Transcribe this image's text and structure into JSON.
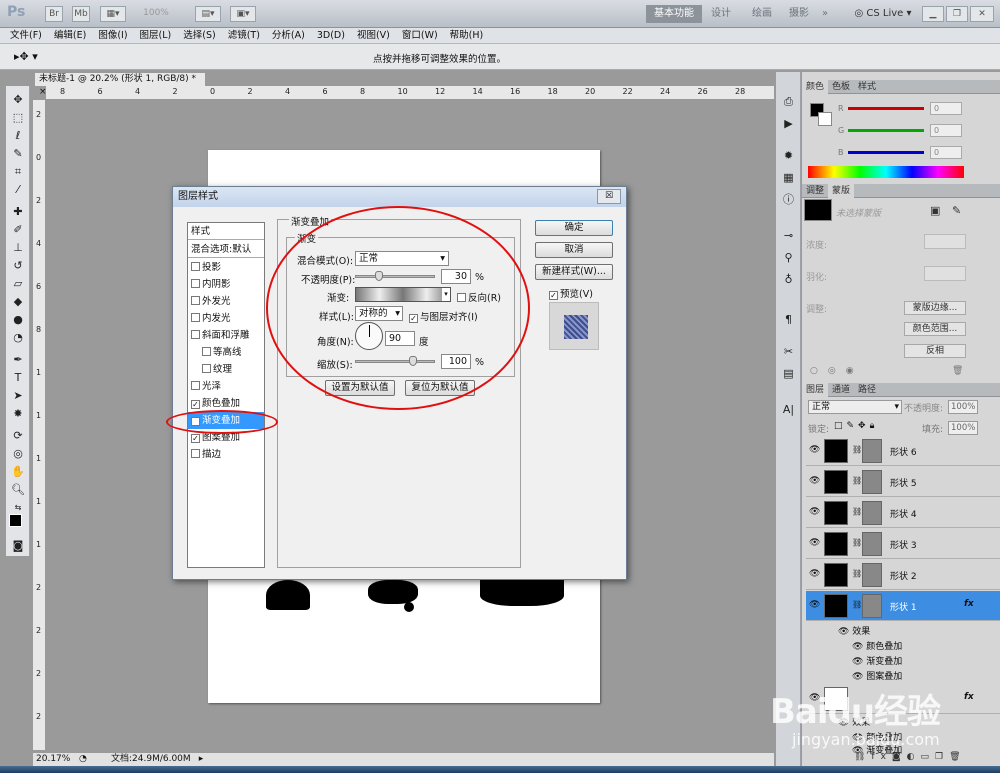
{
  "app": {
    "logo": "Ps",
    "title_tabs": [
      "Br",
      "Mb"
    ],
    "zoom": "100%",
    "workspaces": [
      "基本功能",
      "设计",
      "绘画",
      "摄影"
    ],
    "more": "»",
    "cs_live": "CS Live"
  },
  "menus": [
    "文件(F)",
    "编辑(E)",
    "图像(I)",
    "图层(L)",
    "选择(S)",
    "滤镜(T)",
    "分析(A)",
    "3D(D)",
    "视图(V)",
    "窗口(W)",
    "帮助(H)"
  ],
  "options_hint": "点按并拖移可调整效果的位置。",
  "doc_tab": "未标题-1 @ 20.2% (形状 1, RGB/8) *",
  "ruler_top": [
    "8",
    "6",
    "4",
    "2",
    "0",
    "2",
    "4",
    "6",
    "8",
    "10",
    "12",
    "14",
    "16",
    "18",
    "20",
    "22",
    "24",
    "26",
    "28"
  ],
  "ruler_left": [
    "2",
    "0",
    "2",
    "4",
    "6",
    "8",
    "1",
    "1",
    "1",
    "1",
    "1",
    "2",
    "2",
    "2",
    "2"
  ],
  "status": {
    "zoom": "20.17%",
    "doc": "文档:24.9M/6.00M"
  },
  "dialog": {
    "title": "图层样式",
    "close": "☒",
    "styles_header": "样式",
    "blend_default": "混合选项:默认",
    "styles": [
      {
        "label": "投影",
        "checked": false,
        "indent": false
      },
      {
        "label": "内阴影",
        "checked": false,
        "indent": false
      },
      {
        "label": "外发光",
        "checked": false,
        "indent": false
      },
      {
        "label": "内发光",
        "checked": false,
        "indent": false
      },
      {
        "label": "斜面和浮雕",
        "checked": false,
        "indent": false
      },
      {
        "label": "等高线",
        "checked": false,
        "indent": true
      },
      {
        "label": "纹理",
        "checked": false,
        "indent": true
      },
      {
        "label": "光泽",
        "checked": false,
        "indent": false
      },
      {
        "label": "颜色叠加",
        "checked": true,
        "indent": false
      },
      {
        "label": "渐变叠加",
        "checked": true,
        "indent": false,
        "selected": true
      },
      {
        "label": "图案叠加",
        "checked": true,
        "indent": false
      },
      {
        "label": "描边",
        "checked": false,
        "indent": false
      }
    ],
    "section_title": "渐变叠加",
    "sub_title": "渐变",
    "blend_mode_label": "混合模式(O):",
    "blend_mode": "正常",
    "opacity_label": "不透明度(P):",
    "opacity": "30",
    "opacity_unit": "%",
    "opacity_level": 0.3,
    "gradient_label": "渐变:",
    "reverse_label": "反向(R)",
    "style_label": "样式(L):",
    "style": "对称的",
    "align_label": "与图层对齐(I)",
    "angle_label": "角度(N):",
    "angle": "90",
    "angle_unit": "度",
    "scale_label": "缩放(S):",
    "scale": "100",
    "scale_unit": "%",
    "scale_level": 1.0,
    "set_default": "设置为默认值",
    "reset_default": "复位为默认值",
    "ok": "确定",
    "cancel": "取消",
    "new_style": "新建样式(W)...",
    "preview": "预览(V)"
  },
  "color_panel": {
    "tabs": [
      "颜色",
      "色板",
      "样式"
    ],
    "channels": [
      {
        "ch": "R",
        "value": "0"
      },
      {
        "ch": "G",
        "value": "0"
      },
      {
        "ch": "B",
        "value": "0"
      }
    ]
  },
  "adjust_panel": {
    "tabs": [
      "调整",
      "蒙版"
    ],
    "no_mask": "未选择蒙版",
    "density": "浓度:",
    "feather": "羽化:",
    "refine": "调整:",
    "btn_edge": "蒙版边缘...",
    "btn_range": "颜色范围...",
    "btn_invert": "反相"
  },
  "layers_panel": {
    "tabs": [
      "图层",
      "通道",
      "路径"
    ],
    "mode": "正常",
    "opacity_label": "不透明度:",
    "opacity": "100%",
    "lock_label": "锁定:",
    "fill_label": "填充:",
    "fill": "100%",
    "layers": [
      "形状 6",
      "形状 5",
      "形状 4",
      "形状 3",
      "形状 2",
      "形状 1"
    ],
    "fx": "fx",
    "effects_label": "效果",
    "effects": [
      "颜色叠加",
      "渐变叠加",
      "图案叠加"
    ],
    "bottom_effects": [
      "效果",
      "颜色叠加",
      "渐变叠加"
    ]
  },
  "watermark": {
    "brand": "Baidu经验",
    "url": "jingyan.baidu.com"
  }
}
